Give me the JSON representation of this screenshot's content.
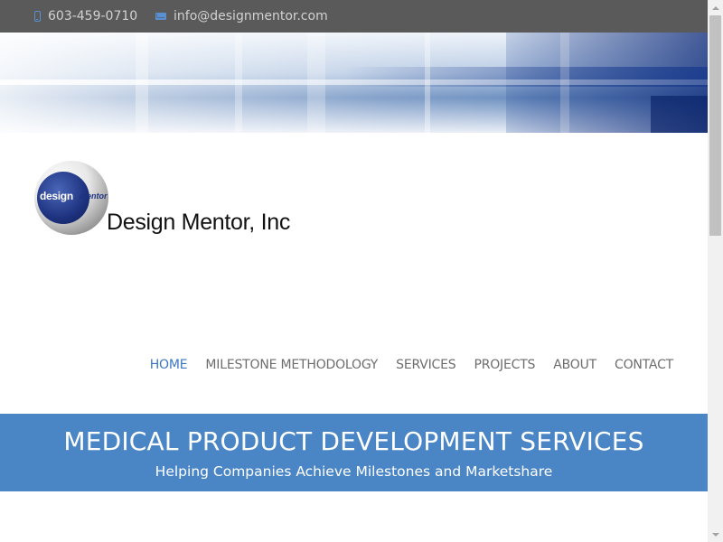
{
  "topbar": {
    "phone": "603-459-0710",
    "email": "info@designmentor.com",
    "phone_icon": "phone-icon",
    "email_icon": "envelope-icon"
  },
  "branding": {
    "logo_word_1": "design",
    "logo_word_2": "mentor",
    "company_name": "Design Mentor, Inc"
  },
  "nav": {
    "items": [
      {
        "label": "HOME",
        "active": true
      },
      {
        "label": "MILESTONE METHODOLOGY",
        "active": false
      },
      {
        "label": "SERVICES",
        "active": false
      },
      {
        "label": "PROJECTS",
        "active": false
      },
      {
        "label": "ABOUT",
        "active": false
      },
      {
        "label": "CONTACT",
        "active": false
      }
    ]
  },
  "hero": {
    "title": "MEDICAL PRODUCT DEVELOPMENT SERVICES",
    "subtitle": "Helping Companies Achieve Milestones and Marketshare"
  },
  "colors": {
    "topbar_bg": "#5a5a5a",
    "accent_blue": "#4a85c6",
    "nav_active": "#3b78c2",
    "nav_text": "#6d6d6d"
  }
}
